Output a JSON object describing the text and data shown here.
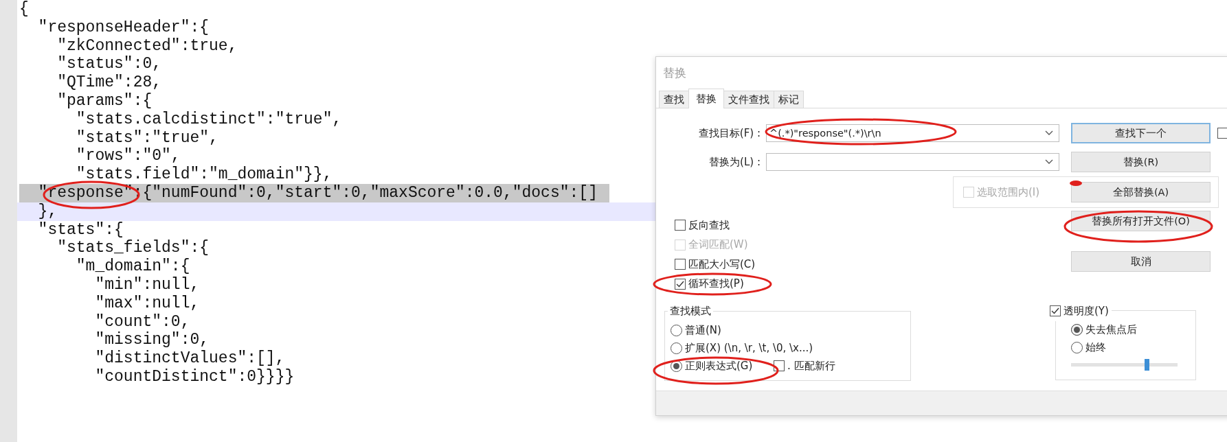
{
  "editor": {
    "lines": [
      {
        "text": "{",
        "selected": false,
        "current": false
      },
      {
        "text": "  \"responseHeader\":{",
        "selected": false,
        "current": false
      },
      {
        "text": "    \"zkConnected\":true,",
        "selected": false,
        "current": false
      },
      {
        "text": "    \"status\":0,",
        "selected": false,
        "current": false
      },
      {
        "text": "    \"QTime\":28,",
        "selected": false,
        "current": false
      },
      {
        "text": "    \"params\":{",
        "selected": false,
        "current": false
      },
      {
        "text": "      \"stats.calcdistinct\":\"true\",",
        "selected": false,
        "current": false
      },
      {
        "text": "      \"stats\":\"true\",",
        "selected": false,
        "current": false
      },
      {
        "text": "      \"rows\":\"0\",",
        "selected": false,
        "current": false
      },
      {
        "text": "      \"stats.field\":\"m_domain\"}},",
        "selected": false,
        "current": false
      },
      {
        "text": "  \"response\":{\"numFound\":0,\"start\":0,\"maxScore\":0.0,\"docs\":[]",
        "selected": true,
        "current": false
      },
      {
        "text": "  },",
        "selected": false,
        "current": true
      },
      {
        "text": "  \"stats\":{",
        "selected": false,
        "current": false
      },
      {
        "text": "    \"stats_fields\":{",
        "selected": false,
        "current": false
      },
      {
        "text": "      \"m_domain\":{",
        "selected": false,
        "current": false
      },
      {
        "text": "        \"min\":null,",
        "selected": false,
        "current": false
      },
      {
        "text": "        \"max\":null,",
        "selected": false,
        "current": false
      },
      {
        "text": "        \"count\":0,",
        "selected": false,
        "current": false
      },
      {
        "text": "        \"missing\":0,",
        "selected": false,
        "current": false
      },
      {
        "text": "        \"distinctValues\":[],",
        "selected": false,
        "current": false
      },
      {
        "text": "        \"countDistinct\":0}}}}",
        "selected": false,
        "current": false
      }
    ]
  },
  "dialog": {
    "title": "替换",
    "tabs": [
      {
        "label": "查找",
        "selected": false
      },
      {
        "label": "替换",
        "selected": true
      },
      {
        "label": "文件查找",
        "selected": false
      },
      {
        "label": "标记",
        "selected": false
      }
    ],
    "find_field": {
      "label": "查找目标(F) :",
      "value": "^(.*)\"response\"(.*)\\r\\n"
    },
    "replace_field": {
      "label": "替换为(L) :"
    },
    "find_next_button": {
      "label": "查找下一个",
      "focused": true
    },
    "edge_checkbox": {
      "checked": false
    },
    "replace_button": {
      "label": "替换(R)",
      "focused": false
    },
    "in_selection": {
      "label": "选取范围内(I)",
      "checked": false,
      "disabled": true
    },
    "replace_all_button": {
      "label": "全部替换(A)",
      "focused": false
    },
    "replace_all_open_button": {
      "label": "替换所有打开文件(O)",
      "focused": false
    },
    "cancel_button": {
      "label": "取消",
      "focused": false
    },
    "options": [
      {
        "label": "反向查找",
        "checked": false,
        "disabled": false
      },
      {
        "label": "全词匹配(W)",
        "checked": false,
        "disabled": true
      },
      {
        "label": "匹配大小写(C)",
        "checked": false,
        "disabled": false
      },
      {
        "label": "循环查找(P)",
        "checked": true,
        "disabled": false
      }
    ],
    "search_mode": {
      "title": "查找模式",
      "modes": [
        {
          "label": "普通(N)",
          "selected": false
        },
        {
          "label": "扩展(X) (\\n, \\r, \\t, \\0, \\x...)",
          "selected": false
        },
        {
          "label": "正则表达式(G)",
          "selected": true
        }
      ],
      "dot_newline": {
        "label": ". 匹配新行",
        "checked": false
      }
    },
    "transparency": {
      "label": "透明度(Y)",
      "checked": true,
      "modes": [
        {
          "label": "失去焦点后",
          "selected": true
        },
        {
          "label": "始终",
          "selected": false
        }
      ],
      "slider": {
        "level": 0.71
      }
    }
  }
}
